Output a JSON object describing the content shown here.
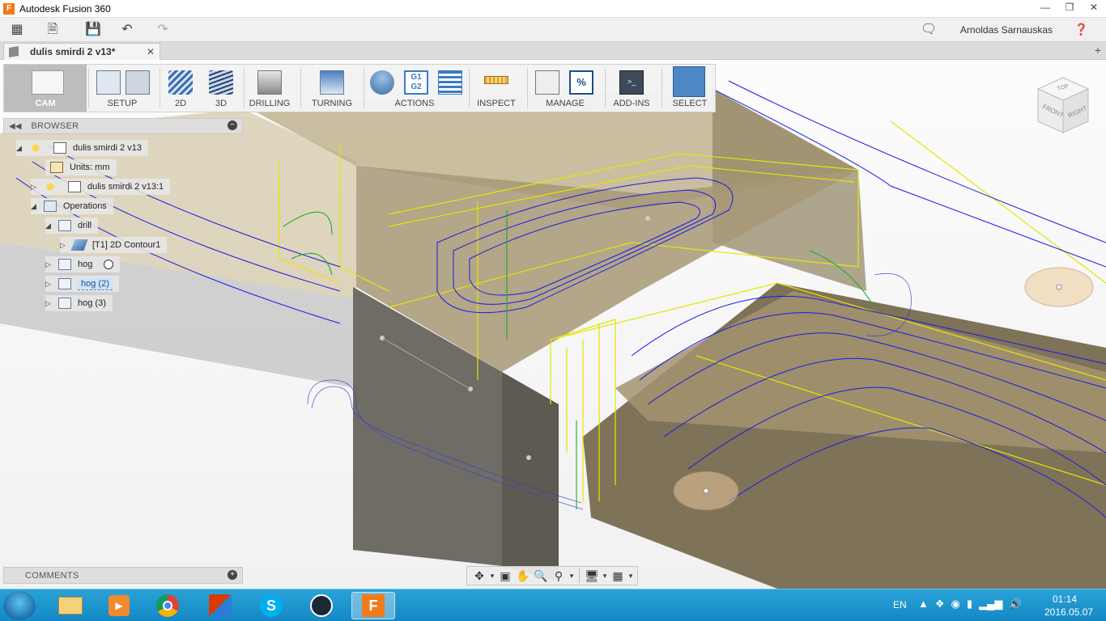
{
  "window": {
    "title": "Autodesk Fusion 360",
    "logo_letter": "F"
  },
  "quick_access": {
    "user_name": "Arnoldas Sarnauskas"
  },
  "document_tab": {
    "name": "dulis smirdi 2 v13*"
  },
  "ribbon": {
    "groups": [
      {
        "label": "CAM"
      },
      {
        "label": "SETUP"
      },
      {
        "label": "2D"
      },
      {
        "label": "3D"
      },
      {
        "label": "DRILLING"
      },
      {
        "label": "TURNING"
      },
      {
        "label": "ACTIONS"
      },
      {
        "label": "INSPECT"
      },
      {
        "label": "MANAGE"
      },
      {
        "label": "ADD-INS"
      },
      {
        "label": "SELECT"
      }
    ],
    "actions_icon_text": [
      "G1",
      "G2"
    ]
  },
  "browser": {
    "title": "BROWSER",
    "items": [
      {
        "label": "dulis smirdi 2 v13"
      },
      {
        "label": "Units: mm"
      },
      {
        "label": "dulis smirdi 2 v13:1"
      },
      {
        "label": "Operations"
      },
      {
        "label": "drill"
      },
      {
        "label": "[T1] 2D Contour1"
      },
      {
        "label": "hog"
      },
      {
        "label": "hog (2)"
      },
      {
        "label": "hog (3)"
      }
    ]
  },
  "comments": {
    "title": "COMMENTS"
  },
  "viewcube": {
    "top": "TOP",
    "front": "FRONT",
    "right": "RIGHT"
  },
  "taskbar": {
    "language": "EN",
    "time": "01:14",
    "date": "2016.05.07"
  },
  "colors": {
    "toolpath_blue": "#1a1ae6",
    "toolpath_yellow": "#e6e600",
    "toolpath_green": "#22aa22",
    "stock_brown": "#8a7a58",
    "accent_orange": "#f07a1e"
  }
}
